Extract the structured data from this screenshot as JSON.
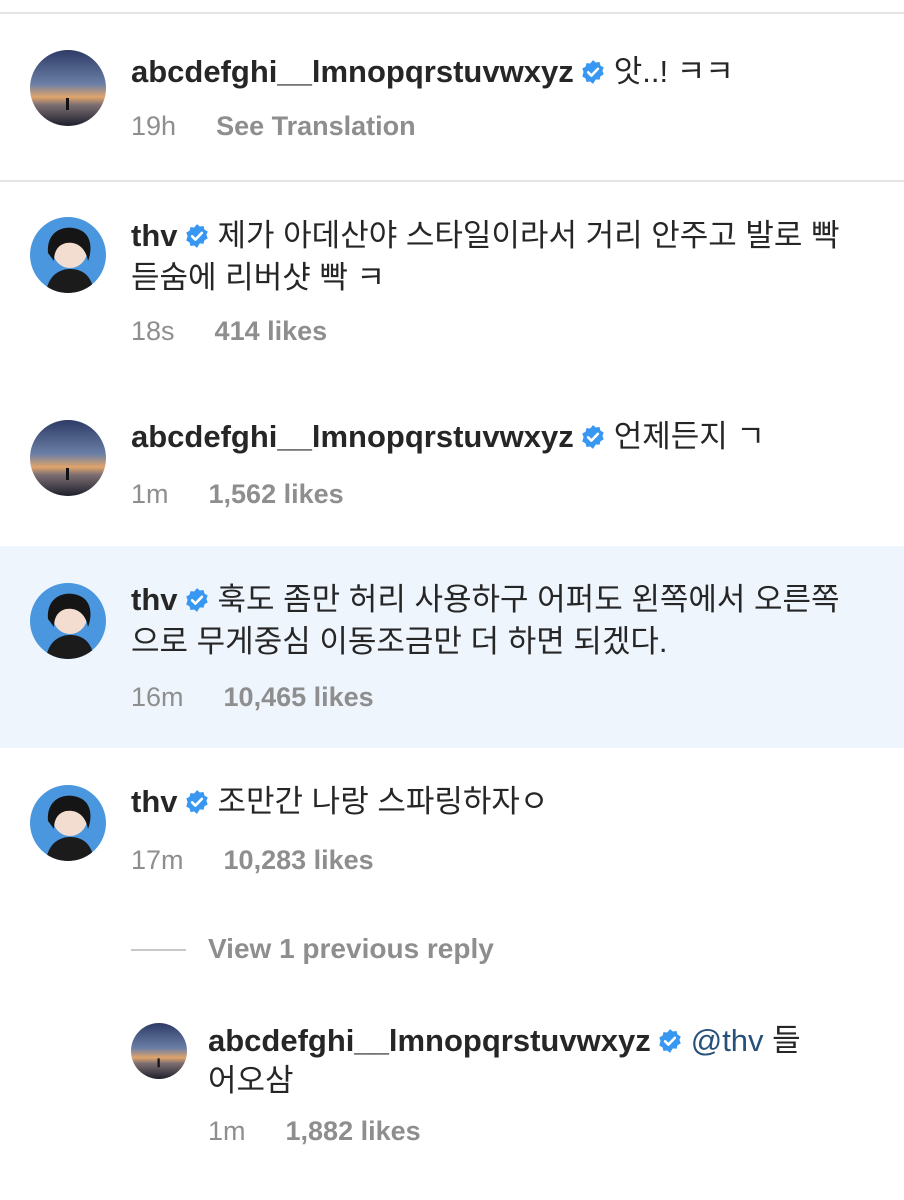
{
  "colors": {
    "verified_blue": "#3897f0",
    "highlight_bg": "#eff5fd",
    "meta_gray": "#8e8e8e",
    "text": "#262626"
  },
  "comments": [
    {
      "username": "abcdefghi__lmnopqrstuvwxyz",
      "avatar": "sunset-avatar",
      "text": "앗..! ㅋㅋ",
      "time": "19h",
      "action": "See Translation"
    },
    {
      "username": "thv",
      "avatar": "portrait-avatar",
      "text_line1": "제가 아데산야 스타일이라서 거리 안주고 발로 빡",
      "text_line2": "듣숨에 리버샷 빡 ㅋ",
      "time": "18s",
      "likes": "414 likes"
    },
    {
      "username": "abcdefghi__lmnopqrstuvwxyz",
      "avatar": "sunset-avatar",
      "text": "언제든지 ㄱ",
      "time": "1m",
      "likes": "1,562 likes"
    },
    {
      "username": "thv",
      "avatar": "portrait-avatar",
      "text_line1": "훅도 좀만 허리 사용하구 어퍼도 왼쪽에서 오른쪽",
      "text_line2": "으로 무게중심 이동조금만 더 하면 되겠다.",
      "time": "16m",
      "likes": "10,465 likes",
      "highlighted": true
    },
    {
      "username": "thv",
      "avatar": "portrait-avatar",
      "text": "조만간 나랑 스파링하자ㅇ",
      "time": "17m",
      "likes": "10,283 likes"
    }
  ],
  "view_replies": "View 1 previous reply",
  "reply": {
    "username": "abcdefghi__lmnopqrstuvwxyz",
    "avatar": "sunset-avatar",
    "mention": "@thv",
    "text_line1_tail": "들",
    "text_line2": "어오삼",
    "time": "1m",
    "likes": "1,882 likes"
  }
}
